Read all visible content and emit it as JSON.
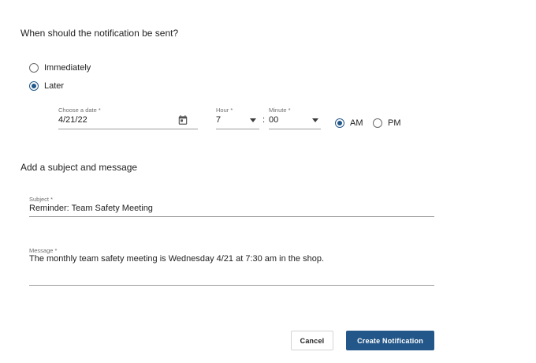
{
  "schedule": {
    "question": "When should the notification be sent?",
    "options": [
      {
        "label": "Immediately",
        "selected": false
      },
      {
        "label": "Later",
        "selected": true
      }
    ],
    "date": {
      "label": "Choose a date *",
      "value": "4/21/22",
      "icon": "calendar-icon"
    },
    "hour": {
      "label": "Hour *",
      "value": "7"
    },
    "minute": {
      "label": "Minute *",
      "value": "00"
    },
    "separator": ":",
    "period": [
      {
        "label": "AM",
        "selected": true
      },
      {
        "label": "PM",
        "selected": false
      }
    ]
  },
  "content": {
    "heading": "Add a subject and message",
    "subject": {
      "label": "Subject *",
      "value": "Reminder: Team Safety Meeting"
    },
    "message": {
      "label": "Message *",
      "value": "The monthly team safety meeting is Wednesday 4/21 at 7:30 am in the shop."
    }
  },
  "actions": {
    "cancel_label": "Cancel",
    "create_label": "Create Notification"
  },
  "colors": {
    "accent": "#235789",
    "underline": "#9c9c9c"
  }
}
